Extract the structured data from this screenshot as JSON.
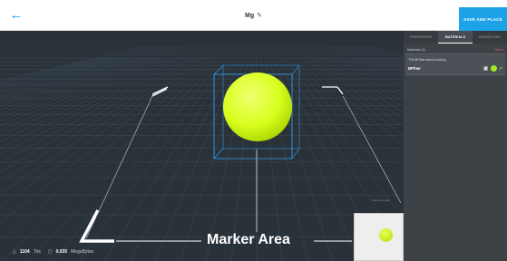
{
  "header": {
    "back_icon": "arrow-left-icon",
    "title": "Mg",
    "edit_icon": "pencil-icon",
    "save_label": "SAVE AND PLACE"
  },
  "viewport": {
    "marker_label": "Marker Area",
    "triangles": "1104",
    "triangles_unit": "Tris",
    "filesize": "0.035",
    "filesize_unit": "MegaBytes",
    "scene_note": "Scene preview",
    "object_color": "#d8ff1e",
    "bbox_color": "#2fa8ff",
    "grid_color": "#3d4a55",
    "background_color": "#2a3239"
  },
  "panel": {
    "tabs": [
      {
        "label": "TRANSFORM"
      },
      {
        "label": "MATERIALS"
      },
      {
        "label": "ANIMATIONS"
      }
    ],
    "active_tab": "MATERIALS",
    "materials_header": "Materials (1)",
    "reset_label": "Reset",
    "material": {
      "title": "THLB/StandardLooking",
      "name": "BPfree",
      "swatch_color": "#a6e81c"
    }
  },
  "colors": {
    "accent": "#1fa3e8",
    "panel_bg": "#3d4247"
  }
}
